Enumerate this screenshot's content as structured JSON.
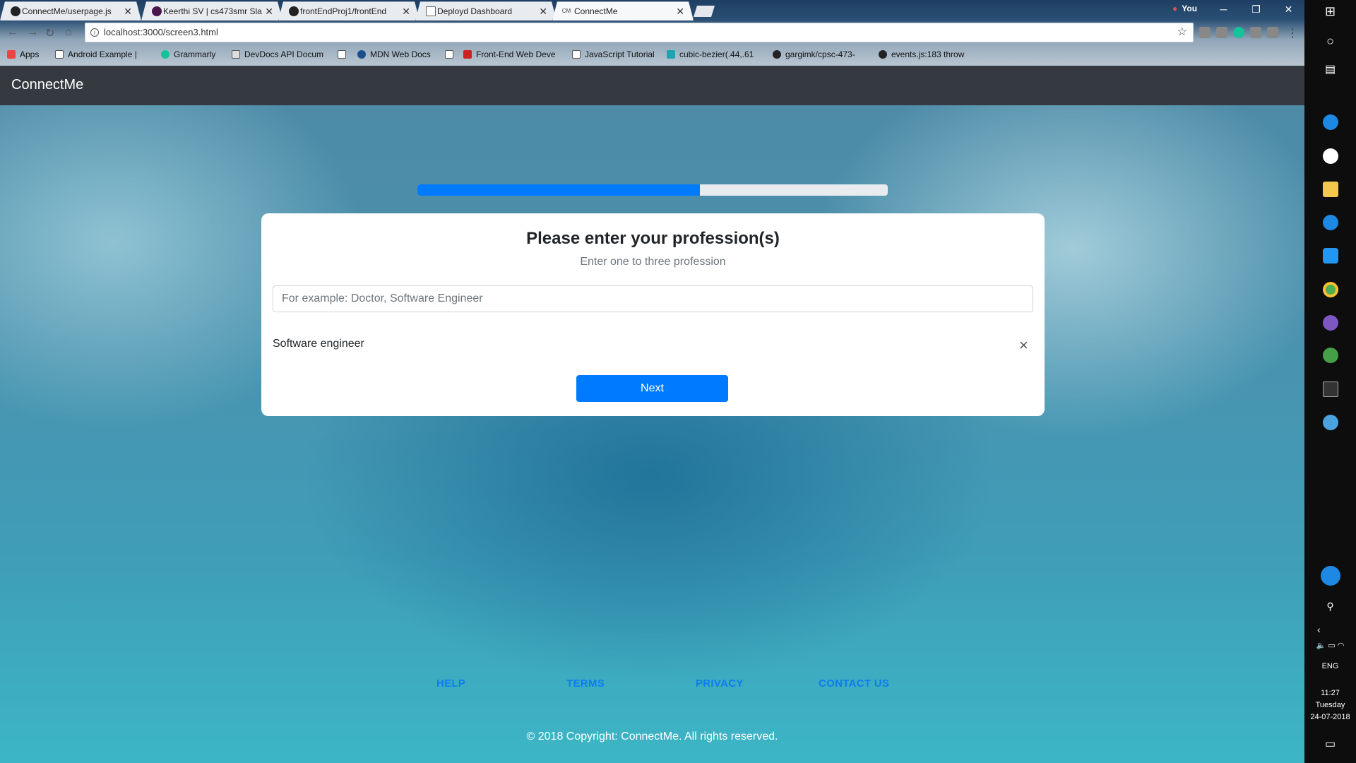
{
  "browser": {
    "tabs": [
      {
        "title": "ConnectMe/userpage.js",
        "favicon": "github-icon",
        "active": false
      },
      {
        "title": "Keerthi SV | cs473smr Sla",
        "favicon": "slack-icon",
        "active": false
      },
      {
        "title": "frontEndProj1/frontEnd",
        "favicon": "github-icon",
        "active": false
      },
      {
        "title": "Deployd Dashboard",
        "favicon": "page-icon",
        "active": false
      },
      {
        "title": "ConnectMe",
        "favicon": "cm-icon",
        "favicon_text": "CM",
        "active": true
      }
    ],
    "profile_name": "You",
    "address": "localhost:3000/screen3.html",
    "bookmarks": [
      {
        "label": "Apps"
      },
      {
        "label": "Android Example |"
      },
      {
        "label": "Grammarly"
      },
      {
        "label": "DevDocs API Docum"
      },
      {
        "label": "MDN Web Docs"
      },
      {
        "label": "Front-End Web Deve"
      },
      {
        "label": "JavaScript Tutorial"
      },
      {
        "label": "cubic-bezier(.44,.61"
      },
      {
        "label": "gargimk/cpsc-473-"
      },
      {
        "label": "events.js:183 throw"
      }
    ]
  },
  "navbar": {
    "brand": "ConnectMe"
  },
  "progress": {
    "percent": 60
  },
  "card": {
    "title": "Please enter your profession(s)",
    "subtitle": "Enter one to three profession",
    "input_placeholder": "For example: Doctor, Software Engineer",
    "input_value": "",
    "professions": [
      "Software engineer"
    ],
    "remove_label": "×",
    "next_label": "Next"
  },
  "footer": {
    "links": [
      "HELP",
      "TERMS",
      "PRIVACY",
      "CONTACT US"
    ],
    "copyright": "© 2018 Copyright: ConnectMe. All rights reserved."
  },
  "taskbar": {
    "language": "ENG",
    "time": "11:27",
    "day": "Tuesday",
    "date": "24-07-2018"
  },
  "colors": {
    "accent": "#007bff",
    "navbar": "#343a40",
    "footer_link": "#0d7cf0"
  }
}
